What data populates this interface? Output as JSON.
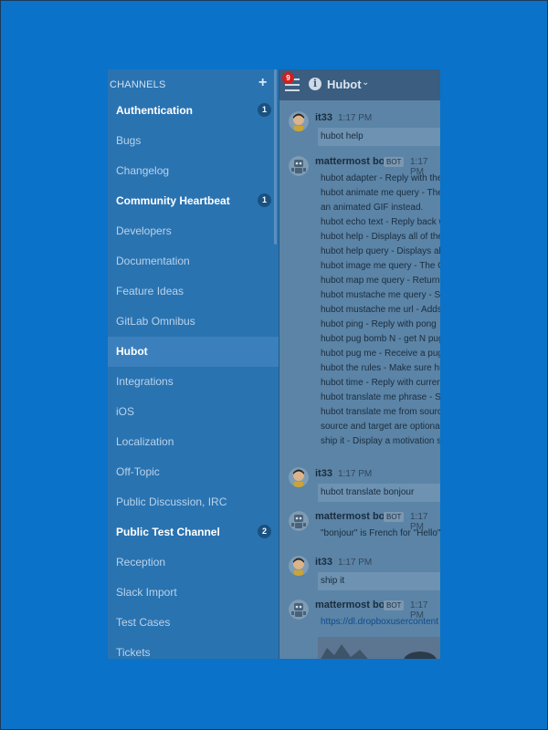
{
  "sidebar": {
    "title": "CHANNELS",
    "add_label": "+",
    "channels": [
      {
        "label": "Authentication",
        "badge": "1",
        "unread": true
      },
      {
        "label": "Bugs"
      },
      {
        "label": "Changelog"
      },
      {
        "label": "Community Heartbeat",
        "badge": "1",
        "unread": true
      },
      {
        "label": "Developers"
      },
      {
        "label": "Documentation"
      },
      {
        "label": "Feature Ideas"
      },
      {
        "label": "GitLab Omnibus"
      },
      {
        "label": "Hubot",
        "active": true
      },
      {
        "label": "Integrations"
      },
      {
        "label": "iOS"
      },
      {
        "label": "Localization"
      },
      {
        "label": "Off-Topic"
      },
      {
        "label": "Public Discussion, IRC"
      },
      {
        "label": "Public Test Channel",
        "badge": "2",
        "unread": true
      },
      {
        "label": "Reception"
      },
      {
        "label": "Slack Import"
      },
      {
        "label": "Test Cases"
      },
      {
        "label": "Tickets"
      }
    ]
  },
  "header": {
    "mention_count": "9",
    "info_icon": "i",
    "channel_name": "Hubot",
    "chevron": "⌄"
  },
  "messages": {
    "m1": {
      "user": "it33",
      "time": "1:17 PM",
      "text": "hubot help"
    },
    "m2": {
      "user": "mattermost bot",
      "bot_label": "BOT",
      "time": "1:17 PM",
      "lines": [
        "hubot adapter - Reply with the",
        "hubot animate me query - The",
        "an animated GIF instead.",
        "hubot echo text - Reply back w",
        "hubot help - Displays all of the",
        "hubot help query - Displays all",
        "hubot image me query - The O",
        "hubot map me query - Returns",
        "hubot mustache me query - Se",
        "hubot mustache me url - Adds",
        "hubot ping - Reply with pong",
        "hubot pug bomb N - get N pug",
        "hubot pug me - Receive a pug",
        "hubot the rules - Make sure hu",
        "hubot time - Reply with curren",
        "hubot translate me phrase - Se",
        "hubot translate me from sourc",
        "source and target are optional",
        "ship it - Display a motivation s"
      ]
    },
    "m3": {
      "user": "it33",
      "time": "1:17 PM",
      "text": "hubot translate bonjour"
    },
    "m4": {
      "user": "mattermost bot",
      "bot_label": "BOT",
      "time": "1:17 PM",
      "text": "\"bonjour\" is French for \"Hello\""
    },
    "m5": {
      "user": "it33",
      "time": "1:17 PM",
      "text": "ship it"
    },
    "m6": {
      "user": "mattermost bot",
      "bot_label": "BOT",
      "time": "1:17 PM",
      "link": "https://dl.dropboxusercontent"
    }
  }
}
